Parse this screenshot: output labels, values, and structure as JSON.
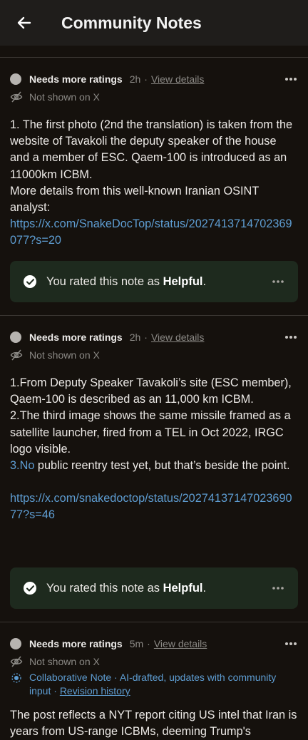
{
  "header": {
    "title": "Community Notes"
  },
  "notes": [
    {
      "status": "Needs more ratings",
      "time": "2h",
      "separator": "·",
      "view_details": "View details",
      "shown": "Not shown on X",
      "body": {
        "p1": "1. The first photo (2nd the translation) is taken from the website of Tavakoli the deputy speaker of the house and a member of ESC. Qaem-100 is introduced as an 11000km ICBM.",
        "p2": "More details from this well-known Iranian OSINT analyst:",
        "link": "https://x.com/SnakeDocTop/status/2027413714702369077?s=20"
      },
      "rated": {
        "prefix": "You rated this note as ",
        "rating": "Helpful",
        "suffix": "."
      }
    },
    {
      "status": "Needs more ratings",
      "time": "2h",
      "separator": "·",
      "view_details": "View details",
      "shown": "Not shown on X",
      "body": {
        "p1": "1.From Deputy Speaker Tavakoli’s site (ESC member), Qaem-100 is described as an 11,000 km ICBM.",
        "p2": "2.The third image shows the same missile framed as a satellite launcher, fired from a TEL in Oct 2022, IRGC logo visible.",
        "p3_link": "3.No",
        "p3_rest": " public reentry test yet, but that’s beside the point.",
        "link": "https://x.com/snakedoctop/status/2027413714702369077?s=46"
      },
      "rated": {
        "prefix": "You rated this note as ",
        "rating": "Helpful",
        "suffix": "."
      }
    },
    {
      "status": "Needs more ratings",
      "time": "5m",
      "separator": "·",
      "view_details": "View details",
      "shown": "Not shown on X",
      "collab": {
        "text": "Collaborative Note · AI-drafted, updates with community input · ",
        "revision": "Revision history"
      },
      "body": {
        "p1": "The post reflects a NYT report citing US intel that Iran is years from US-range ICBMs, deeming Trump's"
      }
    }
  ]
}
